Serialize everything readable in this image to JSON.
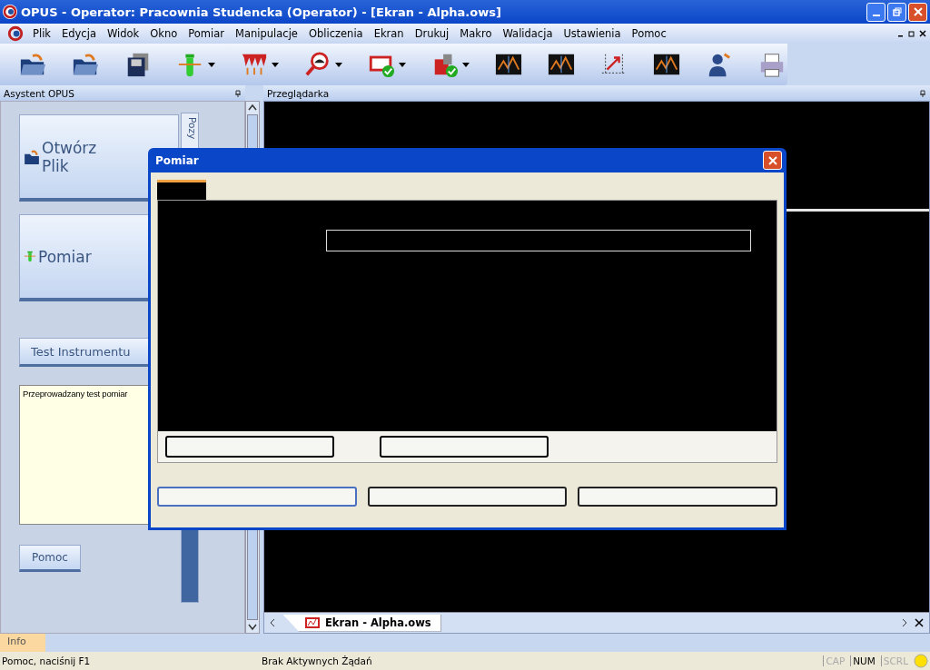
{
  "window": {
    "title": "OPUS - Operator: Pracownia Studencka  (Operator) - [Ekran - Alpha.ows]"
  },
  "menu": [
    "Plik",
    "Edycja",
    "Widok",
    "Okno",
    "Pomiar",
    "Manipulacje",
    "Obliczenia",
    "Ekran",
    "Drukuj",
    "Makro",
    "Walidacja",
    "Ustawienia",
    "Pomoc"
  ],
  "toolbar": [
    {
      "kind": "open",
      "dropdown": false
    },
    {
      "kind": "open",
      "dropdown": false
    },
    {
      "kind": "save",
      "dropdown": false
    },
    {
      "kind": "tube",
      "dropdown": true
    },
    {
      "kind": "peaks",
      "dropdown": true
    },
    {
      "kind": "magnifier",
      "dropdown": true
    },
    {
      "kind": "check-chart",
      "dropdown": true
    },
    {
      "kind": "check-weight",
      "dropdown": true
    },
    {
      "kind": "chart",
      "dropdown": false
    },
    {
      "kind": "chart",
      "dropdown": false
    },
    {
      "kind": "arrow",
      "dropdown": false
    },
    {
      "kind": "chart",
      "dropdown": false
    },
    {
      "kind": "person",
      "dropdown": false
    },
    {
      "kind": "printer",
      "dropdown": false
    }
  ],
  "assistant": {
    "title": "Asystent OPUS",
    "side_tab": "Pozy",
    "open_button": [
      "Otwórz",
      "Plik"
    ],
    "measure_button": "Pomiar",
    "test_button": "Test Instrumentu",
    "note": "Przeprowadzany test pomiar",
    "help_button": "Pomoc"
  },
  "viewer": {
    "title": "Przeglądarka",
    "document_tab": "Ekran - Alpha.ows"
  },
  "dialog": {
    "title": "Pomiar"
  },
  "info_tab": "Info",
  "status_bar": {
    "help": "Pomoc, naciśnij F1",
    "jobs": "Brak Aktywnych Żądań",
    "indicators": [
      {
        "label": "CAP",
        "on": false
      },
      {
        "label": "NUM",
        "on": true
      },
      {
        "label": "SCRL",
        "on": false
      }
    ]
  }
}
